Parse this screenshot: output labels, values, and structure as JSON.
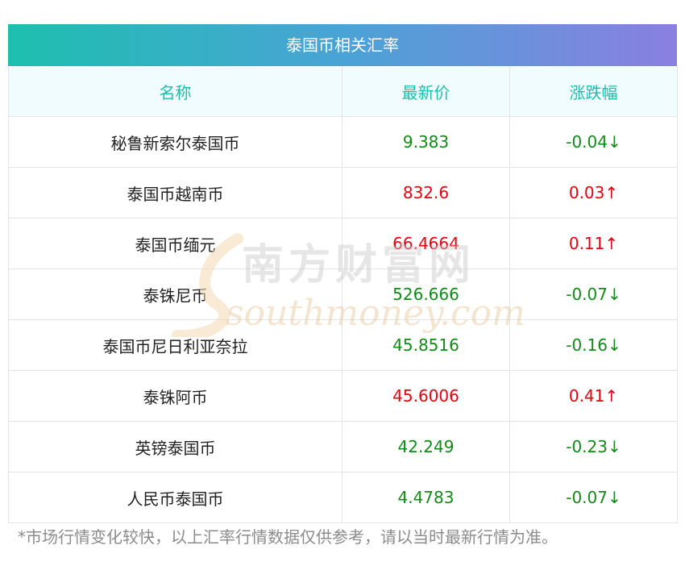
{
  "title": "泰国币相关汇率",
  "headers": {
    "name": "名称",
    "price": "最新价",
    "change": "涨跌幅"
  },
  "rows": [
    {
      "name": "秘鲁新索尔泰国币",
      "price": "9.383",
      "change": "-0.04↓",
      "dir": "down"
    },
    {
      "name": "泰国币越南币",
      "price": "832.6",
      "change": "0.03↑",
      "dir": "up"
    },
    {
      "name": "泰国币缅元",
      "price": "66.4664",
      "change": "0.11↑",
      "dir": "up"
    },
    {
      "name": "泰铢尼币",
      "price": "526.666",
      "change": "-0.07↓",
      "dir": "down"
    },
    {
      "name": "泰国币尼日利亚奈拉",
      "price": "45.8516",
      "change": "-0.16↓",
      "dir": "down"
    },
    {
      "name": "泰铢阿币",
      "price": "45.6006",
      "change": "0.41↑",
      "dir": "up"
    },
    {
      "name": "英镑泰国币",
      "price": "42.249",
      "change": "-0.23↓",
      "dir": "down"
    },
    {
      "name": "人民币泰国币",
      "price": "4.4783",
      "change": "-0.07↓",
      "dir": "down"
    }
  ],
  "watermark": {
    "cn": "南方财富网",
    "en": "southmoney.com"
  },
  "footnote": "*市场行情变化较快，以上汇率行情数据仅供参考，请以当时最新行情为准。",
  "colors": {
    "up": "#e60012",
    "down": "#138a1a",
    "header_text": "#1dbdae",
    "gradient_start": "#1dbfaf",
    "gradient_end": "#8a7fe0"
  }
}
